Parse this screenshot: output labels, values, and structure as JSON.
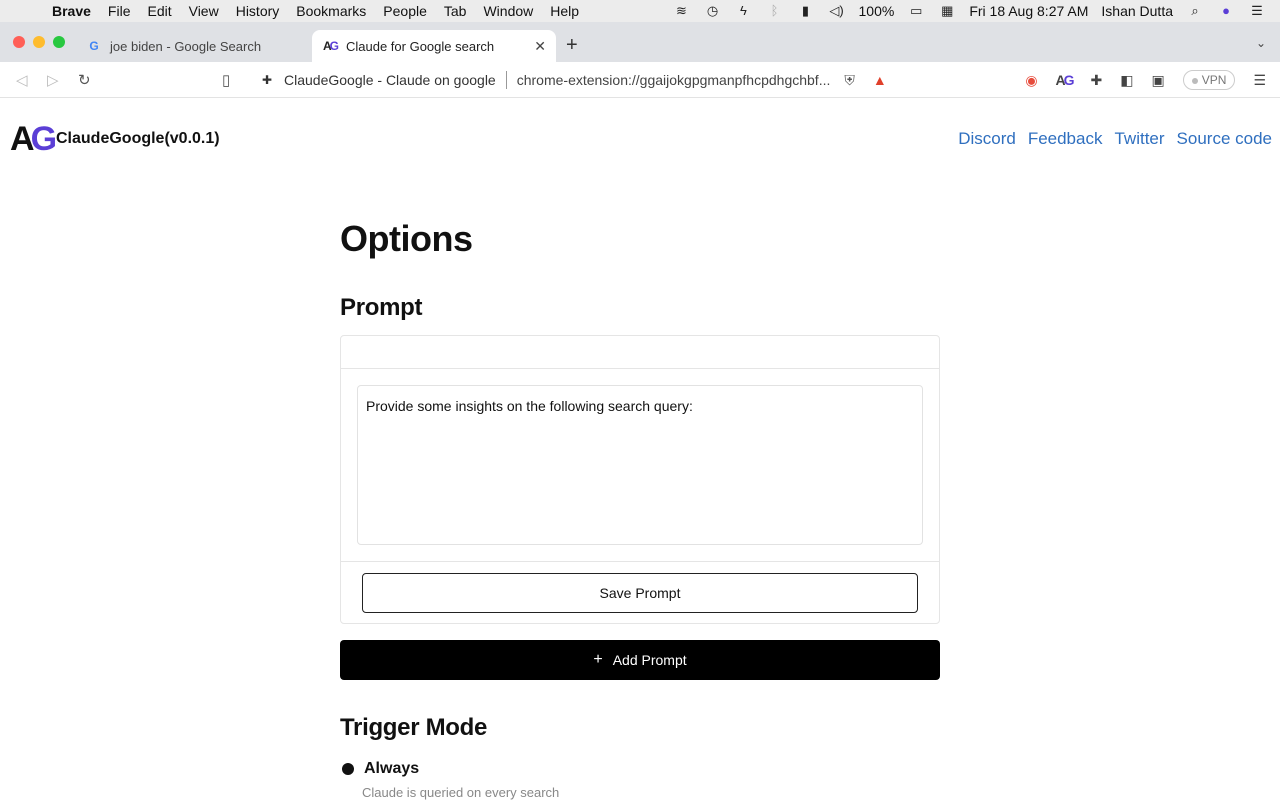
{
  "menubar": {
    "app": "Brave",
    "items": [
      "File",
      "Edit",
      "View",
      "History",
      "Bookmarks",
      "People",
      "Tab",
      "Window",
      "Help"
    ],
    "battery": "100%",
    "datetime": "Fri 18 Aug  8:27 AM",
    "user": "Ishan Dutta"
  },
  "tabs": [
    {
      "title": "joe biden - Google Search",
      "favicon": "google-icon"
    },
    {
      "title": "Claude for Google search",
      "favicon": "ag-logo-icon"
    }
  ],
  "toolbar": {
    "site_name": "ClaudeGoogle - Claude on google",
    "url": "chrome-extension://ggaijokgpgmanpfhcpdhgchbf...",
    "vpn_label": "VPN"
  },
  "header": {
    "logo_text": "AG",
    "brand": "ClaudeGoogle(v0.0.1)",
    "links": [
      "Discord",
      "Feedback",
      "Twitter",
      "Source code"
    ]
  },
  "main": {
    "title": "Options",
    "prompt_heading": "Prompt",
    "prompt_text": "Provide some insights on the following search query:",
    "save_label": "Save Prompt",
    "add_label": "Add Prompt",
    "trigger_heading": "Trigger Mode",
    "trigger_option": "Always",
    "trigger_desc": "Claude is queried on every search"
  },
  "colors": {
    "link": "#2f6fbf",
    "logo_accent": "#5b3fd6",
    "button_primary": "#000000"
  }
}
